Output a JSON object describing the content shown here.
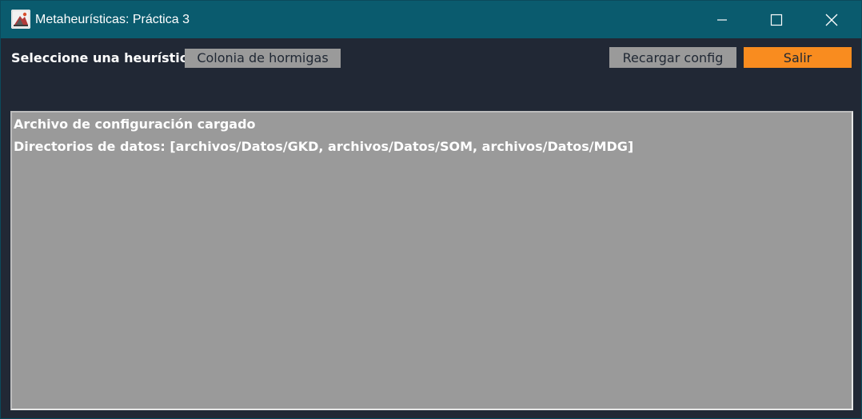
{
  "window": {
    "title": "Metaheurísticas: Práctica 3",
    "icon": "java-app-icon",
    "controls": {
      "minimize_icon": "minimize-icon",
      "maximize_icon": "maximize-icon",
      "close_icon": "close-icon"
    }
  },
  "toolbar": {
    "heuristic_label": "Seleccione una heurística",
    "heuristic_selected": "Colonia de hormigas",
    "reload_label": "Recargar config",
    "exit_label": "Salir"
  },
  "log": {
    "lines": [
      "Archivo de configuración cargado",
      "Directorios de datos: [archivos/Datos/GKD, archivos/Datos/SOM, archivos/Datos/MDG]"
    ]
  },
  "colors": {
    "titlebar": "#0a5b6e",
    "background": "#212835",
    "panel": "#9a9a9a",
    "exit_button": "#f98c1f",
    "text_light": "#ffffff",
    "text_dark": "#1f2733"
  }
}
